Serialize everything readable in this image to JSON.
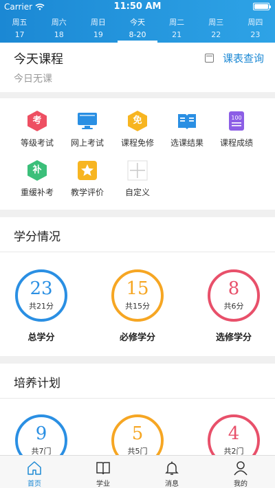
{
  "status": {
    "carrier": "Carrier",
    "time": "11:50 AM",
    "battery": 1.0
  },
  "week": [
    {
      "name": "周五",
      "date": "17"
    },
    {
      "name": "周六",
      "date": "18"
    },
    {
      "name": "周日",
      "date": "19"
    },
    {
      "name": "今天",
      "date": "8-20",
      "active": true
    },
    {
      "name": "周二",
      "date": "21"
    },
    {
      "name": "周三",
      "date": "22"
    },
    {
      "name": "周四",
      "date": "23"
    }
  ],
  "today": {
    "title": "今天课程",
    "subtitle": "今日无课",
    "link": "课表查询"
  },
  "grid": [
    {
      "label": "等级考试",
      "glyph": "考",
      "color": "#ee4f62",
      "icon": "grade-exam-icon"
    },
    {
      "label": "网上考试",
      "glyph": "",
      "color": "#2a8fe3",
      "icon": "online-exam-icon"
    },
    {
      "label": "课程免修",
      "glyph": "免",
      "color": "#f7b521",
      "icon": "course-exempt-icon"
    },
    {
      "label": "选课结果",
      "glyph": "",
      "color": "#2a8fe3",
      "icon": "selection-result-icon"
    },
    {
      "label": "课程成绩",
      "glyph": "100",
      "color": "#8c5ee6",
      "icon": "course-score-icon"
    },
    {
      "label": "重缓补考",
      "glyph": "补",
      "color": "#3bbf7a",
      "icon": "makeup-exam-icon"
    },
    {
      "label": "教学评价",
      "glyph": "★",
      "color": "#f7b521",
      "icon": "teaching-eval-icon"
    },
    {
      "label": "自定义",
      "glyph": "",
      "color": "#cccccc",
      "icon": "plus-icon"
    }
  ],
  "credit": {
    "title": "学分情况",
    "items": [
      {
        "value": "23",
        "total": "共21分",
        "label": "总学分",
        "color": "#2a8fe3"
      },
      {
        "value": "15",
        "total": "共15分",
        "label": "必修学分",
        "color": "#f6a623"
      },
      {
        "value": "8",
        "total": "共6分",
        "label": "选修学分",
        "color": "#e8506a"
      }
    ]
  },
  "plan": {
    "title": "培养计划",
    "items": [
      {
        "value": "9",
        "total": "共7门",
        "color": "#2a8fe3"
      },
      {
        "value": "5",
        "total": "共5门",
        "color": "#f6a623"
      },
      {
        "value": "4",
        "total": "共2门",
        "color": "#e8506a"
      }
    ]
  },
  "tabs": [
    {
      "label": "首页",
      "icon": "home-icon",
      "active": true
    },
    {
      "label": "学业",
      "icon": "book-icon"
    },
    {
      "label": "消息",
      "icon": "bell-icon"
    },
    {
      "label": "我的",
      "icon": "user-icon"
    }
  ]
}
